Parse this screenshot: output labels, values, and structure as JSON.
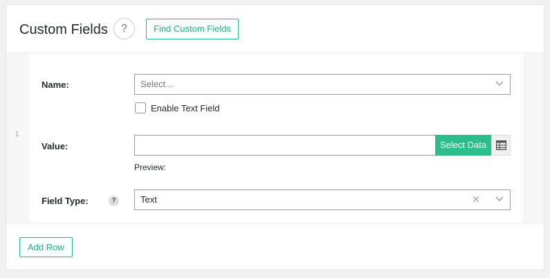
{
  "header": {
    "title": "Custom Fields",
    "help_glyph": "?",
    "find_button": "Find Custom Fields"
  },
  "row": {
    "index": "1",
    "name": {
      "label": "Name:",
      "placeholder": "Select...",
      "enable_text_field_label": "Enable Text Field",
      "enable_text_field_checked": false
    },
    "value": {
      "label": "Value:",
      "input_value": "",
      "select_data_button": "Select Data",
      "table_icon": "table-icon",
      "preview_label": "Preview:"
    },
    "field_type": {
      "label": "Field Type:",
      "help_glyph": "?",
      "selected": "Text"
    }
  },
  "footer": {
    "add_row_button": "Add Row"
  },
  "colors": {
    "accent": "#2bbd8c",
    "accent_text": "#1fae87"
  }
}
